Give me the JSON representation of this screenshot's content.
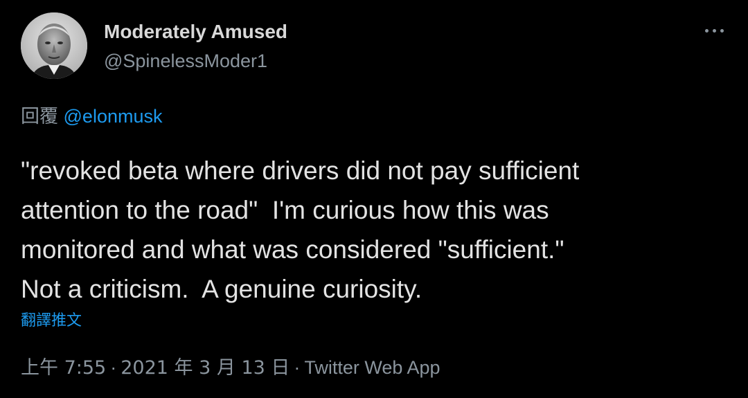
{
  "author": {
    "display_name": "Moderately Amused",
    "handle": "@SpinelessModer1"
  },
  "more_icon": "more-horizontal-icon",
  "reply": {
    "prefix": "回覆",
    "mention": "@elonmusk"
  },
  "tweet": {
    "text": "\"revoked beta where drivers did not pay sufficient\nattention to the road\"  I'm curious how this was\nmonitored and what was considered \"sufficient.\"\nNot a criticism.  A genuine curiosity.",
    "translate_label": "翻譯推文"
  },
  "meta": {
    "time": "上午 7:55",
    "separator": "·",
    "date": "2021 年 3 月 13 日",
    "source": "Twitter Web App"
  },
  "colors": {
    "background": "#000000",
    "link": "#1d9bf0",
    "secondary_text": "#8b959e",
    "primary_text": "#e3e3e3"
  }
}
